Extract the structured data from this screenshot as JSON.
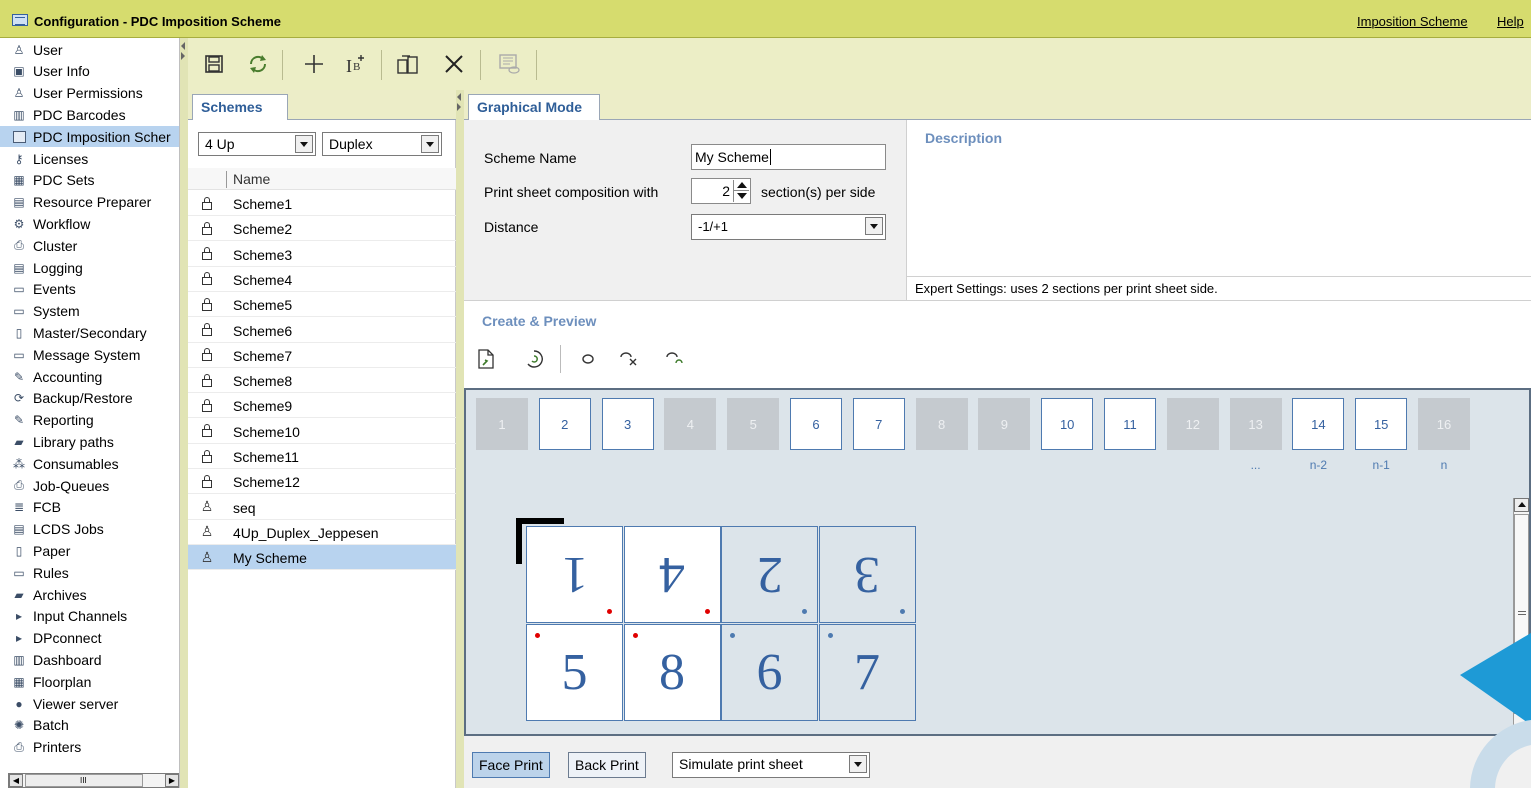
{
  "window": {
    "title": "Configuration - PDC Imposition Scheme",
    "menu_imposition": "Imposition Scheme",
    "menu_help": "Help"
  },
  "sidebar": {
    "items": [
      {
        "label": "User",
        "icon": "user-icon"
      },
      {
        "label": "User Info",
        "icon": "info-card-icon"
      },
      {
        "label": "User Permissions",
        "icon": "users-icon"
      },
      {
        "label": "PDC Barcodes",
        "icon": "barcode-icon"
      },
      {
        "label": "PDC Imposition Scher",
        "icon": "imposition-icon"
      },
      {
        "label": "Licenses",
        "icon": "key-icon"
      },
      {
        "label": "PDC Sets",
        "icon": "sets-icon"
      },
      {
        "label": "Resource Preparer",
        "icon": "document-icon"
      },
      {
        "label": "Workflow",
        "icon": "workflow-icon"
      },
      {
        "label": "Cluster",
        "icon": "printer-icon"
      },
      {
        "label": "Logging",
        "icon": "log-icon"
      },
      {
        "label": "Events",
        "icon": "events-icon"
      },
      {
        "label": "System",
        "icon": "monitor-icon"
      },
      {
        "label": "Master/Secondary",
        "icon": "server-icon"
      },
      {
        "label": "Message System",
        "icon": "message-icon"
      },
      {
        "label": "Accounting",
        "icon": "accounting-icon"
      },
      {
        "label": "Backup/Restore",
        "icon": "backup-icon"
      },
      {
        "label": "Reporting",
        "icon": "reporting-icon"
      },
      {
        "label": "Library paths",
        "icon": "library-icon"
      },
      {
        "label": "Consumables",
        "icon": "consumables-icon"
      },
      {
        "label": "Job-Queues",
        "icon": "queue-icon"
      },
      {
        "label": "FCB",
        "icon": "fcb-icon"
      },
      {
        "label": "LCDS Jobs",
        "icon": "lcds-icon"
      },
      {
        "label": "Paper",
        "icon": "paper-icon"
      },
      {
        "label": "Rules",
        "icon": "rules-icon"
      },
      {
        "label": "Archives",
        "icon": "archive-icon"
      },
      {
        "label": "Input Channels",
        "icon": "input-channel-icon"
      },
      {
        "label": "DPconnect",
        "icon": "dpconnect-icon"
      },
      {
        "label": "Dashboard",
        "icon": "dashboard-icon"
      },
      {
        "label": "Floorplan",
        "icon": "floorplan-icon"
      },
      {
        "label": "Viewer server",
        "icon": "eye-icon"
      },
      {
        "label": "Batch",
        "icon": "batch-icon"
      },
      {
        "label": "Printers",
        "icon": "printer-icon"
      }
    ],
    "selected_index": 4,
    "scroll_thumb_glyph": "III"
  },
  "toolbar": {
    "buttons": [
      "save-icon",
      "refresh-icon",
      "add-icon",
      "add-text-icon",
      "copy-icon",
      "delete-icon",
      "preview-icon"
    ]
  },
  "schemes": {
    "tab_label": "Schemes",
    "filter_up": "4 Up",
    "filter_mode": "Duplex",
    "column_header": "Name",
    "rows": [
      {
        "name": "Scheme1",
        "type": "locked"
      },
      {
        "name": "Scheme2",
        "type": "locked"
      },
      {
        "name": "Scheme3",
        "type": "locked"
      },
      {
        "name": "Scheme4",
        "type": "locked"
      },
      {
        "name": "Scheme5",
        "type": "locked"
      },
      {
        "name": "Scheme6",
        "type": "locked"
      },
      {
        "name": "Scheme7",
        "type": "locked"
      },
      {
        "name": "Scheme8",
        "type": "locked"
      },
      {
        "name": "Scheme9",
        "type": "locked"
      },
      {
        "name": "Scheme10",
        "type": "locked"
      },
      {
        "name": "Scheme11",
        "type": "locked"
      },
      {
        "name": "Scheme12",
        "type": "locked"
      },
      {
        "name": "seq",
        "type": "user"
      },
      {
        "name": "4Up_Duplex_Jeppesen",
        "type": "user"
      },
      {
        "name": "My Scheme",
        "type": "user"
      }
    ],
    "selected_index": 14
  },
  "graphical_mode": {
    "tab_label": "Graphical Mode",
    "scheme_name_label": "Scheme Name",
    "scheme_name_value": "My Scheme",
    "composition_label": "Print sheet composition with",
    "composition_value": "2",
    "composition_suffix": "section(s) per side",
    "distance_label": "Distance",
    "distance_value": "-1/+1",
    "description_header": "Description",
    "expert_settings": "Expert Settings: uses 2 sections per print sheet side.",
    "create_preview_header": "Create & Preview",
    "preview_tools": [
      "new-page-icon",
      "rotate-icon",
      "loop-icon",
      "loop-delete-icon",
      "loop-refresh-icon"
    ]
  },
  "sections": {
    "items": [
      {
        "num": "1",
        "active": false
      },
      {
        "num": "2",
        "active": true
      },
      {
        "num": "3",
        "active": true
      },
      {
        "num": "4",
        "active": false
      },
      {
        "num": "5",
        "active": false
      },
      {
        "num": "6",
        "active": true
      },
      {
        "num": "7",
        "active": true
      },
      {
        "num": "8",
        "active": false
      },
      {
        "num": "9",
        "active": false
      },
      {
        "num": "10",
        "active": true
      },
      {
        "num": "11",
        "active": true
      },
      {
        "num": "12",
        "active": false
      },
      {
        "num": "13",
        "active": false
      },
      {
        "num": "14",
        "active": true
      },
      {
        "num": "15",
        "active": true
      },
      {
        "num": "16",
        "active": false
      }
    ],
    "labels": {
      "ellipsis": "...",
      "n_minus_2": "n-2",
      "n_minus_1": "n-1",
      "n": "n"
    }
  },
  "sheet": {
    "top_row": [
      {
        "num": "1",
        "face": "white",
        "flipped": true,
        "dot": "red"
      },
      {
        "num": "4",
        "face": "white",
        "flipped": true,
        "dot": "red"
      },
      {
        "num": "2",
        "face": "grey",
        "flipped": true,
        "dot": "blue"
      },
      {
        "num": "3",
        "face": "grey",
        "flipped": true,
        "dot": "blue"
      }
    ],
    "bottom_row": [
      {
        "num": "5",
        "face": "white",
        "flipped": false,
        "dot": "red"
      },
      {
        "num": "8",
        "face": "white",
        "flipped": false,
        "dot": "red"
      },
      {
        "num": "6",
        "face": "grey",
        "flipped": false,
        "dot": "blue"
      },
      {
        "num": "7",
        "face": "grey",
        "flipped": false,
        "dot": "blue"
      }
    ]
  },
  "bottom_bar": {
    "face_print": "Face Print",
    "back_print": "Back Print",
    "simulate": "Simulate print sheet"
  },
  "colors": {
    "titlebar": "#d6dc6e",
    "accent_blue": "#2f5e98",
    "selection": "#b8d3ef",
    "red_dot": "#e00000",
    "decor_cyan": "#1e9ad6"
  }
}
